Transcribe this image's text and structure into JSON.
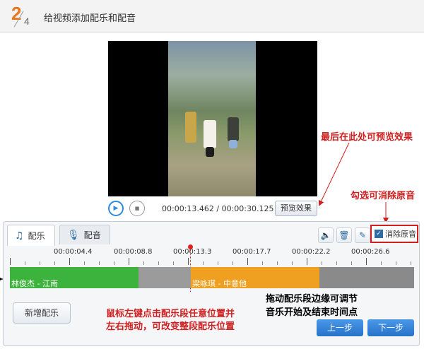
{
  "header": {
    "step_current": "2",
    "step_total": "4",
    "title": "给视频添加配乐和配音"
  },
  "player": {
    "time_display": "00:00:13.462 / 00:00:30.125",
    "preview_label": "预览效果"
  },
  "annotations": {
    "preview_hint": "最后在此处可预览效果",
    "mute_hint": "勾选可消除原音",
    "drag_edge_hint": [
      "拖动配乐段边缘可调节",
      "音乐开始及结束时间点"
    ],
    "drag_segment_hint": [
      "鼠标左键点击配乐段任意位置并",
      "左右拖动，可改变整段配乐位置"
    ]
  },
  "tabs": [
    {
      "label": "配乐",
      "icon": "music-note-icon"
    },
    {
      "label": "配音",
      "icon": "microphone-icon"
    }
  ],
  "toolbar": {
    "mute_original_label": "消除原音",
    "mute_original_checked": true
  },
  "ruler": {
    "ticks": [
      "00:00:04.4",
      "00:00:08.8",
      "00:00:13.3",
      "00:00:17.7",
      "00:00:22.2",
      "00:00:26.6"
    ]
  },
  "track": {
    "segments": [
      {
        "label": "林俊杰 - 江南",
        "color": "#3cb33c"
      },
      {
        "label": "梁咏琪 - 中意他",
        "color": "#f0a020"
      }
    ]
  },
  "buttons": {
    "add_music": "新增配乐",
    "prev": "上一步",
    "next": "下一步"
  },
  "colors": {
    "accent": "#2e8be0",
    "annotation": "#d01f1f",
    "step": "#e87722"
  }
}
